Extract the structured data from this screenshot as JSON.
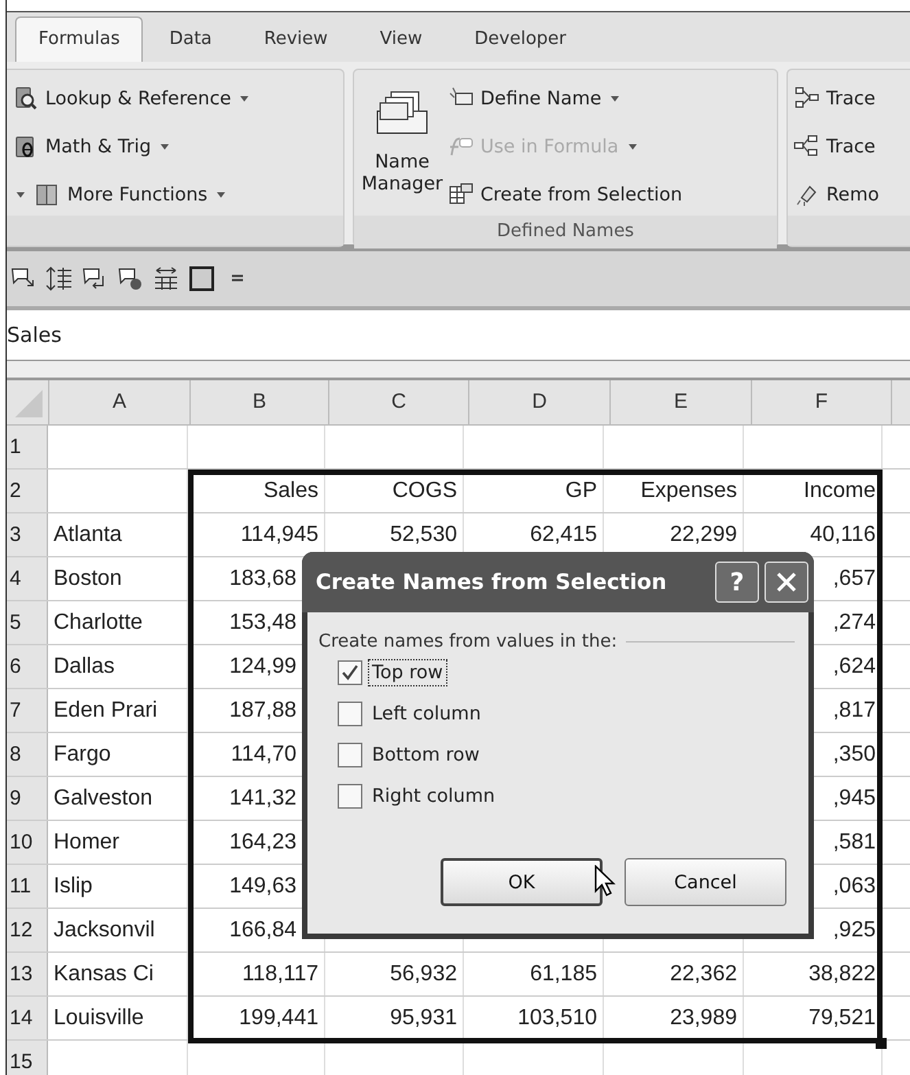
{
  "tabs": [
    {
      "label": "Formulas",
      "selected": true
    },
    {
      "label": "Data",
      "selected": false
    },
    {
      "label": "Review",
      "selected": false
    },
    {
      "label": "View",
      "selected": false
    },
    {
      "label": "Developer",
      "selected": false
    }
  ],
  "ribbon": {
    "groups": [
      {
        "kind": "list",
        "items": [
          {
            "label": "Lookup & Reference",
            "dropdown": true,
            "disabled": false
          },
          {
            "label": "Math & Trig",
            "dropdown": true,
            "disabled": false
          },
          {
            "label": "More Functions",
            "dropdown": true,
            "disabled": false,
            "left_caret": true
          }
        ]
      },
      {
        "kind": "names",
        "title": "Defined Names",
        "large_button": "Name Manager",
        "items": [
          {
            "label": "Define Name",
            "dropdown": true,
            "disabled": false
          },
          {
            "label": "Use in Formula",
            "dropdown": true,
            "disabled": true
          },
          {
            "label": "Create from Selection",
            "dropdown": false,
            "disabled": false
          }
        ]
      },
      {
        "kind": "list",
        "items": [
          {
            "label": "Trace",
            "dropdown": false,
            "disabled": false
          },
          {
            "label": "Trace",
            "dropdown": false,
            "disabled": false
          },
          {
            "label": "Remo",
            "dropdown": false,
            "disabled": false
          }
        ]
      }
    ]
  },
  "name_box": "Sales",
  "sheet": {
    "columns": [
      "A",
      "B",
      "C",
      "D",
      "E",
      "F"
    ],
    "rows": [
      {
        "number": "1",
        "cells": [
          "",
          "",
          "",
          "",
          "",
          ""
        ]
      },
      {
        "number": "2",
        "cells": [
          "",
          "Sales",
          "COGS",
          "GP",
          "Expenses",
          "Income"
        ]
      },
      {
        "number": "3",
        "cells": [
          "Atlanta",
          "114,945",
          "52,530",
          "62,415",
          "22,299",
          "40,116"
        ]
      },
      {
        "number": "4",
        "cells": [
          "Boston",
          "183,68",
          null,
          null,
          null,
          ",657"
        ]
      },
      {
        "number": "5",
        "cells": [
          "Charlotte",
          "153,48",
          null,
          null,
          null,
          ",274"
        ]
      },
      {
        "number": "6",
        "cells": [
          "Dallas",
          "124,99",
          null,
          null,
          null,
          ",624"
        ]
      },
      {
        "number": "7",
        "cells": [
          "Eden Prari",
          "187,88",
          null,
          null,
          null,
          ",817"
        ]
      },
      {
        "number": "8",
        "cells": [
          "Fargo",
          "114,70",
          null,
          null,
          null,
          ",350"
        ]
      },
      {
        "number": "9",
        "cells": [
          "Galveston",
          "141,32",
          null,
          null,
          null,
          ",945"
        ]
      },
      {
        "number": "10",
        "cells": [
          "Homer",
          "164,23",
          null,
          null,
          null,
          ",581"
        ]
      },
      {
        "number": "11",
        "cells": [
          "Islip",
          "149,63",
          null,
          null,
          null,
          ",063"
        ]
      },
      {
        "number": "12",
        "cells": [
          "Jacksonvil",
          "166,84",
          null,
          null,
          null,
          ",925"
        ]
      },
      {
        "number": "13",
        "cells": [
          "Kansas Ci",
          "118,117",
          "56,932",
          "61,185",
          "22,362",
          "38,822"
        ]
      },
      {
        "number": "14",
        "cells": [
          "Louisville",
          "199,441",
          "95,931",
          "103,510",
          "23,989",
          "79,521"
        ]
      },
      {
        "number": "15",
        "cells": [
          "",
          "",
          "",
          "",
          "",
          ""
        ]
      }
    ]
  },
  "dialog": {
    "title": "Create Names from Selection",
    "help": "?",
    "group_label": "Create names from values in the:",
    "options": [
      {
        "label": "Top row",
        "checked": true,
        "focused": true
      },
      {
        "label": "Left column",
        "checked": false,
        "focused": false
      },
      {
        "label": "Bottom row",
        "checked": false,
        "focused": false
      },
      {
        "label": "Right column",
        "checked": false,
        "focused": false
      }
    ],
    "buttons": [
      {
        "label": "OK",
        "default": true
      },
      {
        "label": "Cancel",
        "default": false
      }
    ]
  }
}
